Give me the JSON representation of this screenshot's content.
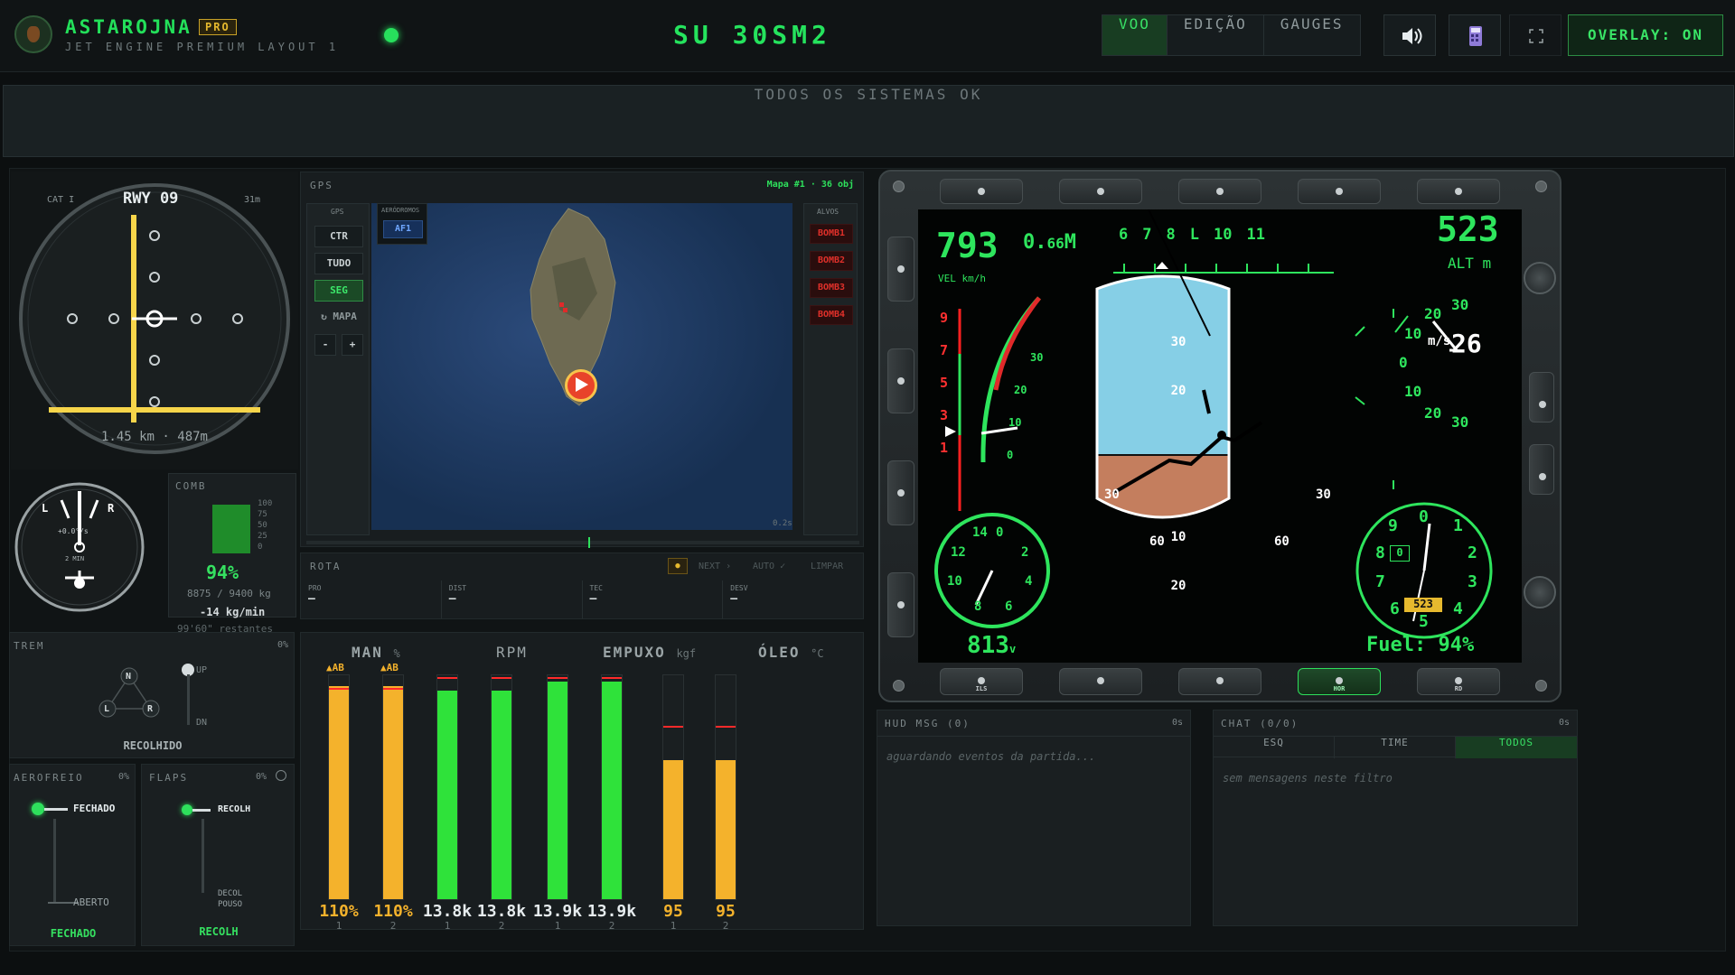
{
  "header": {
    "brand": "ASTAROJNA",
    "badge": "PRO",
    "subtitle": "JET ENGINE PREMIUM LAYOUT 1",
    "callsign": "SU 30SM2",
    "tabs": [
      {
        "label": "VOO",
        "active": true
      },
      {
        "label": "EDIÇÃO",
        "active": false
      },
      {
        "label": "GAUGES",
        "active": false
      }
    ],
    "icons": [
      "speaker-icon",
      "calculator-icon",
      "fullscreen-icon"
    ],
    "overlay_label": "OVERLAY: ON",
    "accent": "#27e05c"
  },
  "status_text": "TODOS OS SISTEMAS OK",
  "ils": {
    "cat": "CAT I",
    "runway": "RWY 09",
    "height": "31m",
    "distance": "1.45 km · 487m"
  },
  "turn": {
    "left": "L",
    "right": "R",
    "rate": "+0.0°/s",
    "label": "2 MIN"
  },
  "fuel": {
    "title": "COMB",
    "scale": [
      "100",
      "75",
      "50",
      "25",
      "0"
    ],
    "percent": "94%",
    "level": 0.94,
    "mass": "8875 / 9400 kg",
    "flow": "-14 kg/min",
    "remaining": "99'60\" restantes"
  },
  "gps": {
    "title": "GPS",
    "map_info": "Mapa #1 · 36 obj",
    "left_label": "GPS",
    "buttons": [
      "CTR",
      "TUDO",
      "SEG",
      "↻ MAPA"
    ],
    "zoom_minus": "-",
    "zoom_plus": "+",
    "aero_label": "AERÓDROMOS",
    "aero_items": [
      "AF1"
    ],
    "targets_label": "ALVOS",
    "targets": [
      "BOMB1",
      "BOMB2",
      "BOMB3",
      "BOMB4"
    ],
    "timer": "0.2s"
  },
  "rota": {
    "title": "ROTA",
    "actions": [
      "NEXT ›",
      "AUTO ✓",
      "LIMPAR"
    ],
    "cols": [
      {
        "k": "PRO",
        "v": "—"
      },
      {
        "k": "DIST",
        "v": "—"
      },
      {
        "k": "TEC",
        "v": "—"
      },
      {
        "k": "DESV",
        "v": "—"
      }
    ]
  },
  "gear": {
    "title": "TREM",
    "pct": "0%",
    "up": "UP",
    "dn": "DN",
    "n": "N",
    "l": "L",
    "r": "R",
    "state": "RECOLHIDO"
  },
  "airbrake": {
    "title": "AEROFREIO",
    "pct": "0%",
    "top": "FECHADO",
    "bottom": "ABERTO",
    "state": "FECHADO"
  },
  "flaps": {
    "title": "FLAPS",
    "pct": "0%",
    "top": "RECOLH",
    "mid1": "DECOL",
    "mid2": "POUSO",
    "state": "RECOLH"
  },
  "engines": {
    "groups": [
      {
        "name": "MAN",
        "unit": "%",
        "values": [
          "110%",
          "110%"
        ],
        "levels": [
          0.95,
          0.95
        ],
        "color": "#f4b22c",
        "tag": "▲AB"
      },
      {
        "name": "RPM",
        "unit": "",
        "values": [
          "13.8k",
          "13.8k"
        ],
        "levels": [
          0.93,
          0.93
        ],
        "color": "#2fe23a",
        "tag": ""
      },
      {
        "name": "EMPUXO",
        "unit": "kgf",
        "values": [
          "13.9k",
          "13.9k"
        ],
        "levels": [
          0.97,
          0.97
        ],
        "color": "#2fe23a",
        "tag": ""
      },
      {
        "name": "ÓLEO",
        "unit": "°C",
        "values": [
          "95",
          "95"
        ],
        "levels": [
          0.62,
          0.62
        ],
        "color": "#f4b22c",
        "tag": ""
      }
    ],
    "idx": [
      "1",
      "2"
    ]
  },
  "mfd": {
    "speed": "793",
    "mach_prefix": "0.",
    "mach": "66",
    "mach_unit": "M",
    "speed_unit": "VEL km/h",
    "heading_labels": [
      "6",
      "7",
      "8",
      "L",
      "10",
      "11"
    ],
    "alt": "523",
    "alt_unit": "ALT m",
    "vs_value": "26",
    "vs_unit": "m/s",
    "vs_ticks": [
      "30",
      "20",
      "10",
      "0",
      "10",
      "20",
      "30"
    ],
    "g_ticks": [
      "9",
      "7",
      "5",
      "3",
      "1"
    ],
    "aoa_ticks": [
      "30",
      "20",
      "10",
      "0"
    ],
    "pitch": [
      "30",
      "20",
      "10",
      "10",
      "20"
    ],
    "bank": [
      "30",
      "30",
      "60",
      "60"
    ],
    "ias_ticks": [
      "14",
      "0",
      "2",
      "4",
      "6",
      "8",
      "10",
      "12"
    ],
    "ias": "813",
    "ias_unit": "v",
    "alt_dial": [
      "0",
      "1",
      "2",
      "3",
      "4",
      "5",
      "6",
      "7",
      "8",
      "9"
    ],
    "alt_dial_window": "0",
    "alt_dial_box": "523",
    "fuel": "Fuel: 94%",
    "bottom_keys": [
      "ILS",
      "",
      "",
      "HOR",
      "RD"
    ]
  },
  "hud": {
    "title": "HUD MSG (0)",
    "time": "0s",
    "placeholder": "aguardando eventos da partida..."
  },
  "chat": {
    "title": "CHAT (0/0)",
    "time": "0s",
    "tabs": [
      {
        "label": "ESQ",
        "active": false
      },
      {
        "label": "TIME",
        "active": false
      },
      {
        "label": "TODOS",
        "active": true
      }
    ],
    "placeholder": "sem mensagens neste filtro"
  }
}
